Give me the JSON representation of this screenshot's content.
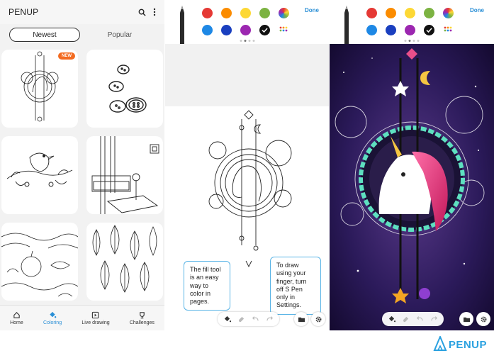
{
  "panel1": {
    "app_title": "PENUP",
    "tabs": [
      "Newest",
      "Popular"
    ],
    "new_badge": "NEW",
    "nav": [
      {
        "label": "Home",
        "icon": "home-icon"
      },
      {
        "label": "Coloring",
        "icon": "coloring-icon"
      },
      {
        "label": "Live drawing",
        "icon": "live-drawing-icon"
      },
      {
        "label": "Challenges",
        "icon": "trophy-icon"
      }
    ],
    "accent_color": "#2a8fd6"
  },
  "palette": {
    "done_label": "Done",
    "colors_row1": [
      "#e53935",
      "#fb8c00",
      "#fdd835",
      "#7cb342",
      "spectrum"
    ],
    "colors_row2": [
      "#1e88e5",
      "#1a3fbf",
      "#9c27b0",
      "#111111",
      "more"
    ],
    "selected": "#111111"
  },
  "panel2": {
    "tip_fill": "The fill tool is an easy way to color in pages.",
    "tip_finger": "To draw using your finger, turn off S Pen only in Settings."
  },
  "toolbar": {
    "icons": [
      "fill-icon",
      "eraser-icon",
      "undo-icon",
      "redo-icon"
    ],
    "folder_icon": "folder-icon",
    "settings_icon": "gear-icon"
  },
  "logo": {
    "text": "PENUP"
  }
}
